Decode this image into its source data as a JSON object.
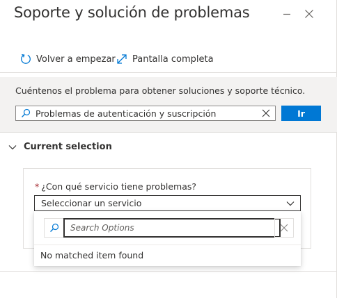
{
  "header": {
    "title": "Soporte y solución de problemas",
    "icons": [
      "minimize-icon",
      "close-icon"
    ]
  },
  "toolbar": {
    "restart_label": "Volver a empezar",
    "fullscreen_label": "Pantalla completa"
  },
  "search": {
    "description": "Cuéntenos el problema para obtener soluciones y soporte técnico.",
    "value": "Problemas de autenticación y suscripción",
    "go_label": "Ir"
  },
  "section": {
    "title": "Current selection",
    "expanded": true
  },
  "service": {
    "required_mark": "*",
    "question": "¿Con qué servicio tiene problemas?",
    "selected": "Seleccionar un servicio",
    "options_search_placeholder": "Search Options",
    "empty_message": "No matched item found"
  },
  "colors": {
    "accent": "#0078d4",
    "band_background": "#f3f2f1",
    "required": "#a4262c",
    "text": "#323130"
  }
}
